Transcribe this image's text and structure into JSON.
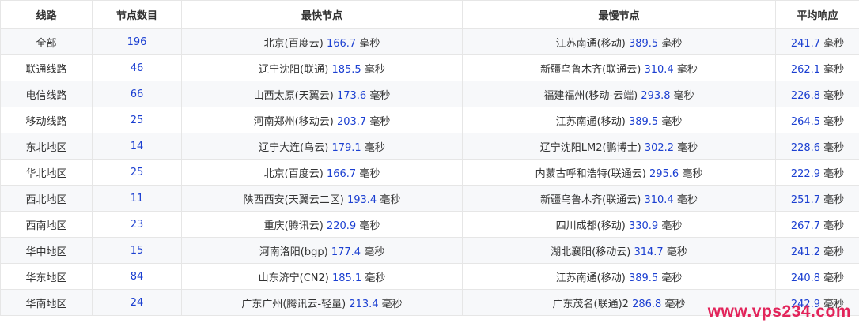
{
  "headers": [
    "线路",
    "节点数目",
    "最快节点",
    "最慢节点",
    "平均响应"
  ],
  "unit": "毫秒",
  "rows": [
    {
      "line": "全部",
      "count": "196",
      "fast_node": "北京(百度云)",
      "fast_ms": "166.7",
      "slow_node": "江苏南通(移动)",
      "slow_ms": "389.5",
      "avg_ms": "241.7"
    },
    {
      "line": "联通线路",
      "count": "46",
      "fast_node": "辽宁沈阳(联通)",
      "fast_ms": "185.5",
      "slow_node": "新疆乌鲁木齐(联通云)",
      "slow_ms": "310.4",
      "avg_ms": "262.1"
    },
    {
      "line": "电信线路",
      "count": "66",
      "fast_node": "山西太原(天翼云)",
      "fast_ms": "173.6",
      "slow_node": "福建福州(移动-云端)",
      "slow_ms": "293.8",
      "avg_ms": "226.8"
    },
    {
      "line": "移动线路",
      "count": "25",
      "fast_node": "河南郑州(移动云)",
      "fast_ms": "203.7",
      "slow_node": "江苏南通(移动)",
      "slow_ms": "389.5",
      "avg_ms": "264.5"
    },
    {
      "line": "东北地区",
      "count": "14",
      "fast_node": "辽宁大连(鸟云)",
      "fast_ms": "179.1",
      "slow_node": "辽宁沈阳LM2(鹏博士)",
      "slow_ms": "302.2",
      "avg_ms": "228.6"
    },
    {
      "line": "华北地区",
      "count": "25",
      "fast_node": "北京(百度云)",
      "fast_ms": "166.7",
      "slow_node": "内蒙古呼和浩特(联通云)",
      "slow_ms": "295.6",
      "avg_ms": "222.9"
    },
    {
      "line": "西北地区",
      "count": "11",
      "fast_node": "陕西西安(天翼云二区)",
      "fast_ms": "193.4",
      "slow_node": "新疆乌鲁木齐(联通云)",
      "slow_ms": "310.4",
      "avg_ms": "251.7"
    },
    {
      "line": "西南地区",
      "count": "23",
      "fast_node": "重庆(腾讯云)",
      "fast_ms": "220.9",
      "slow_node": "四川成都(移动)",
      "slow_ms": "330.9",
      "avg_ms": "267.7"
    },
    {
      "line": "华中地区",
      "count": "15",
      "fast_node": "河南洛阳(bgp)",
      "fast_ms": "177.4",
      "slow_node": "湖北襄阳(移动云)",
      "slow_ms": "314.7",
      "avg_ms": "241.2"
    },
    {
      "line": "华东地区",
      "count": "84",
      "fast_node": "山东济宁(CN2)",
      "fast_ms": "185.1",
      "slow_node": "江苏南通(移动)",
      "slow_ms": "389.5",
      "avg_ms": "240.8"
    },
    {
      "line": "华南地区",
      "count": "24",
      "fast_node": "广东广州(腾讯云-轻量)",
      "fast_ms": "213.4",
      "slow_node": "广东茂名(联通)2",
      "slow_ms": "286.8",
      "avg_ms": "242.9"
    }
  ],
  "watermark": "www.vps234.com",
  "colors": {
    "value": "#1b3fd1",
    "watermark": "#e2245a",
    "row_alt": "#f7f8fa",
    "border": "#e6e6e6"
  }
}
